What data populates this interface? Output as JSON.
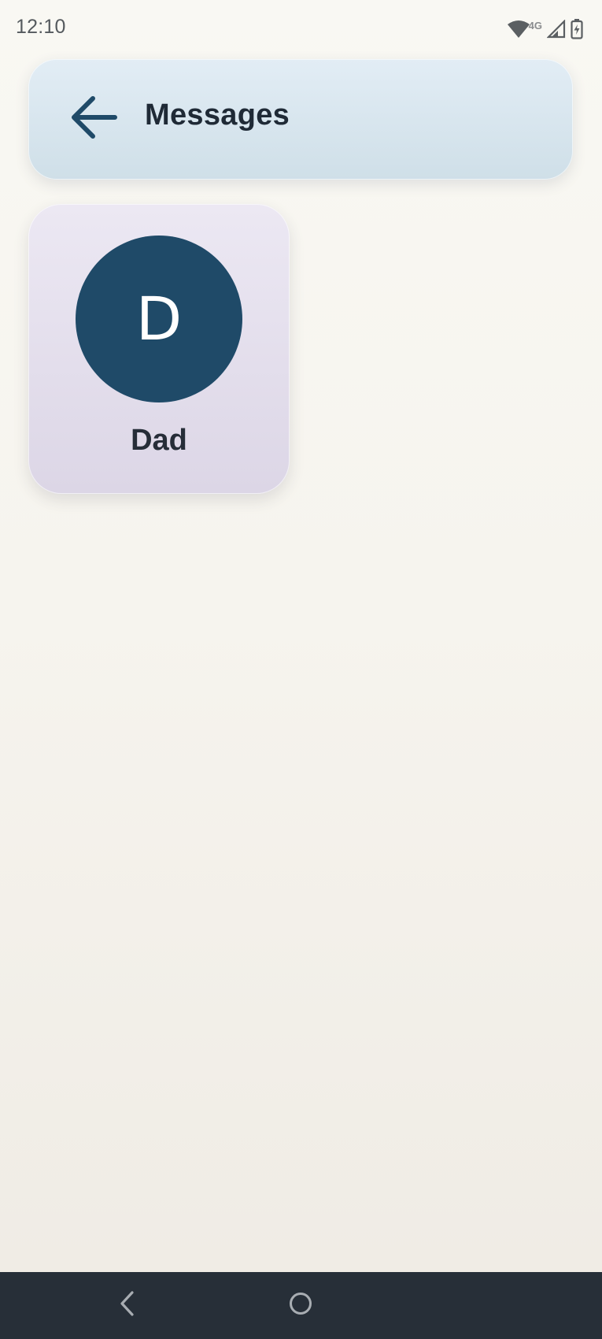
{
  "status_bar": {
    "time": "12:10",
    "network_type": "4G",
    "icons": [
      "wifi-icon",
      "cellular-signal-icon",
      "battery-charging-icon"
    ]
  },
  "header": {
    "title": "Messages",
    "back_icon": "arrow-left-icon"
  },
  "contacts": [
    {
      "initial": "D",
      "name": "Dad",
      "avatar_color": "#1f4a68"
    }
  ],
  "nav_bar": {
    "icons": [
      "nav-back-icon",
      "nav-home-icon"
    ]
  },
  "colors": {
    "accent": "#1f4a68",
    "header_bg": "#d9e7f0",
    "tile_bg": "#e4dfec",
    "nav_bg": "#272f38"
  }
}
